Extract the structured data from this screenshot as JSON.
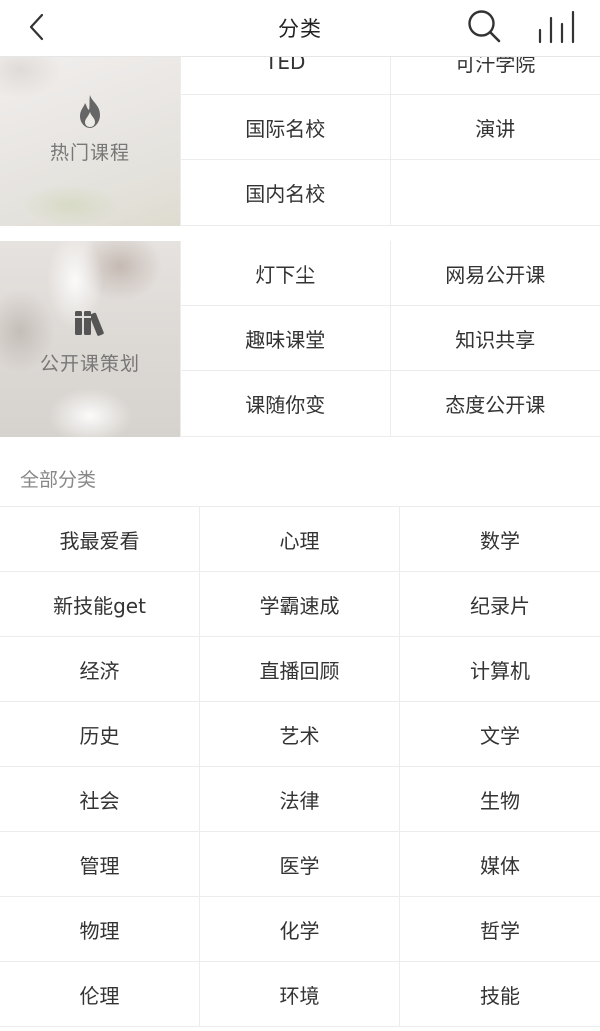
{
  "header": {
    "title": "分类",
    "back_icon": "chevron-left-icon",
    "search_icon": "search-icon",
    "ranking_icon": "bar-chart-icon"
  },
  "hot_courses": {
    "label": "热门课程",
    "icon": "flame-icon",
    "items": [
      "TED",
      "可汗学院",
      "国际名校",
      "演讲",
      "国内名校",
      ""
    ]
  },
  "open_planning": {
    "label": "公开课策划",
    "icon": "books-icon",
    "items": [
      "灯下尘",
      "网易公开课",
      "趣味课堂",
      "知识共享",
      "课随你变",
      "态度公开课"
    ]
  },
  "all_categories": {
    "title": "全部分类",
    "items": [
      "我最爱看",
      "心理",
      "数学",
      "新技能get",
      "学霸速成",
      "纪录片",
      "经济",
      "直播回顾",
      "计算机",
      "历史",
      "艺术",
      "文学",
      "社会",
      "法律",
      "生物",
      "管理",
      "医学",
      "媒体",
      "物理",
      "化学",
      "哲学",
      "伦理",
      "环境",
      "技能"
    ]
  },
  "colors": {
    "divider": "#ececec",
    "text": "#333333",
    "muted": "#888888",
    "banner_label": "#777777"
  }
}
